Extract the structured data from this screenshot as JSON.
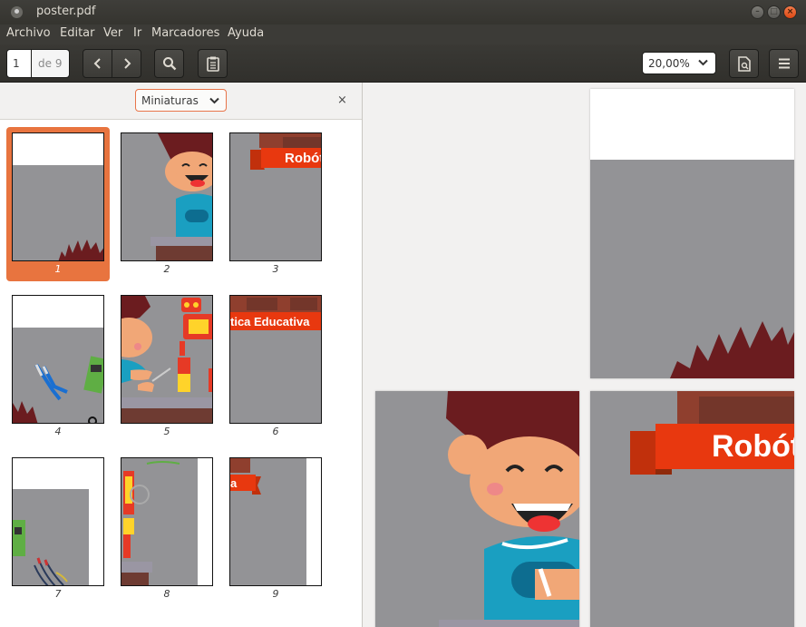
{
  "window": {
    "title": "poster.pdf"
  },
  "menu": [
    "Archivo",
    "Editar",
    "Ver",
    "Ir",
    "Marcadores",
    "Ayuda"
  ],
  "toolbar": {
    "page_current": "1",
    "page_of": "de 9",
    "zoom": "20,00%"
  },
  "sidebar": {
    "mode": "Miniaturas",
    "close_label": "×",
    "thumbnails": [
      {
        "number": "1",
        "selected": true
      },
      {
        "number": "2",
        "selected": false
      },
      {
        "number": "3",
        "selected": false
      },
      {
        "number": "4",
        "selected": false
      },
      {
        "number": "5",
        "selected": false
      },
      {
        "number": "6",
        "selected": false
      },
      {
        "number": "7",
        "selected": false
      },
      {
        "number": "8",
        "selected": false
      },
      {
        "number": "9",
        "selected": false
      }
    ]
  },
  "content": {
    "banner_text_thumb3": "Robót",
    "banner_text_thumb6": "tica Educativa",
    "banner_text_thumb9": "a",
    "banner_text_page3": "Robót"
  },
  "colors": {
    "accent": "#e8743f",
    "banner": "#e8380f",
    "page_gray": "#939396"
  }
}
